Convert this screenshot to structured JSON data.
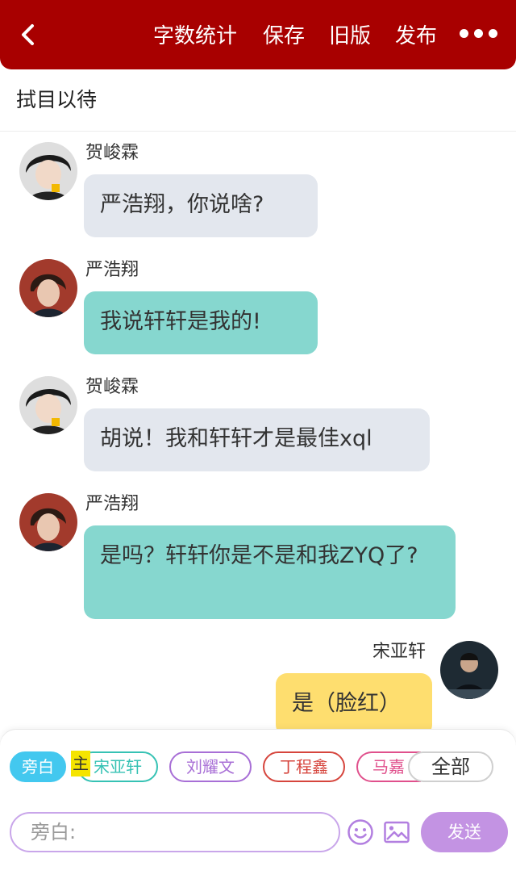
{
  "header": {
    "actions": [
      "字数统计",
      "保存",
      "旧版",
      "发布"
    ],
    "back_icon": "chevron-left-icon",
    "more_icon": "more-dots-icon",
    "background": "#a80000"
  },
  "title": "拭目以待",
  "messages": [
    {
      "name": "贺峻霖",
      "text": "严浩翔，你说啥?",
      "side": "left",
      "color": "#e3e7ee"
    },
    {
      "name": "严浩翔",
      "text": "我说轩轩是我的!",
      "side": "left",
      "color": "#86d7cf"
    },
    {
      "name": "贺峻霖",
      "text": "胡说！我和轩轩才是最佳xql",
      "side": "left",
      "color": "#e3e7ee"
    },
    {
      "name": "严浩翔",
      "text": "是吗？轩轩你是不是和我ZYQ了?",
      "side": "left",
      "color": "#86d7cf"
    },
    {
      "name": "宋亚轩",
      "text": "是（脸红）",
      "side": "right",
      "color": "#fede6f"
    }
  ],
  "roles": {
    "aside": "旁白",
    "main_tag": "主",
    "chips": [
      {
        "label": "宋亚轩",
        "color": "#36c2b4"
      },
      {
        "label": "刘耀文",
        "color": "#a86fd6"
      },
      {
        "label": "丁程鑫",
        "color": "#d6453d"
      },
      {
        "label": "马嘉",
        "color": "#e0508c"
      }
    ],
    "all": "全部"
  },
  "composer": {
    "placeholder": "旁白:",
    "send": "发送",
    "emoji_icon": "emoji-icon",
    "image_icon": "image-icon",
    "accent": "#c393e3"
  }
}
